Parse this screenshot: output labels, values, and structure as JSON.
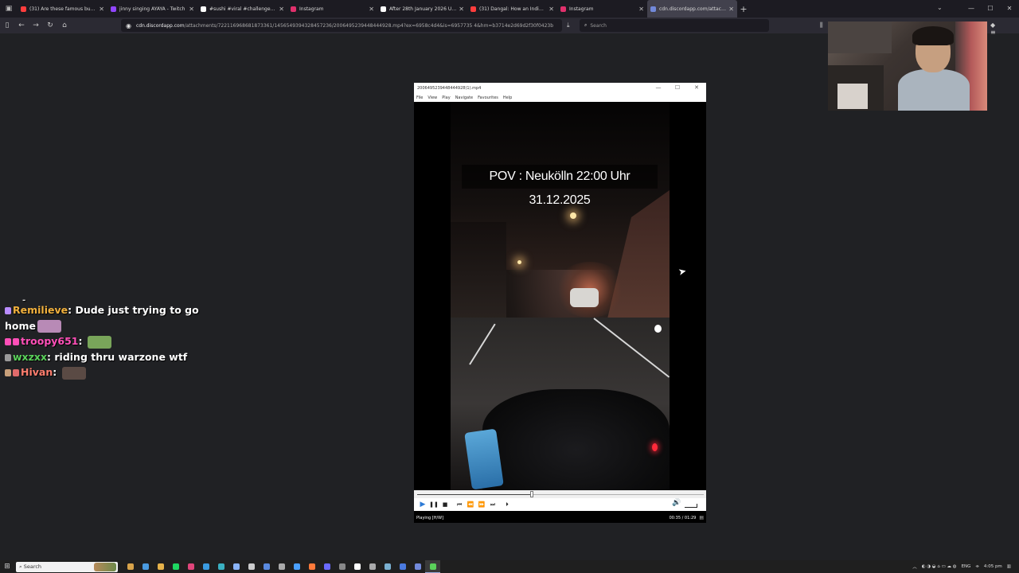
{
  "browser": {
    "tabs": [
      {
        "title": "(31) Are these famous butter c",
        "color": "#ff3d3d",
        "active": false
      },
      {
        "title": "jinny singing AYAYA - Twitch",
        "color": "#9146ff",
        "active": false
      },
      {
        "title": "#sushi #viral #challenge #puzzl",
        "color": "#ffffff",
        "active": false
      },
      {
        "title": "Instagram",
        "color": "#e1306c",
        "active": false
      },
      {
        "title": "After 28th January 2026 U Can",
        "color": "#ffffff",
        "active": false
      },
      {
        "title": "(31) Dangal: How an Indian Fil",
        "color": "#ff3d3d",
        "active": false
      },
      {
        "title": "Instagram",
        "color": "#e1306c",
        "active": false
      },
      {
        "title": "cdn.discordapp.com/attachments/7",
        "color": "#7289da",
        "active": true
      }
    ],
    "new_tab": "+",
    "url_domain": "cdn.discordapp.com",
    "url_path": "/attachments/722116968681873361/1456549394328457236/2006495239448444928.mp4?ex=6958c4d4&is=6957735 4&hm=b3714e2d69d2f30f0423b",
    "search_placeholder": "Search"
  },
  "player": {
    "window_title": "2006495239448444928(1).mp4",
    "menu": [
      "File",
      "View",
      "Play",
      "Navigate",
      "Favourites",
      "Help"
    ],
    "video_caption": "POV : Neukölln 22:00 Uhr 31.12.2025",
    "status": "Playing [H/W]",
    "time_current": "00:35",
    "time_total": "01:29",
    "progress": 0.4,
    "controls": [
      "play",
      "pause",
      "stop",
      "prev",
      "rewind",
      "forward",
      "next",
      "step"
    ]
  },
  "chat": [
    {
      "user": "Remilieve",
      "user_color": "#f2b13d",
      "badges": [
        "#b98cff"
      ],
      "message": "Dude just trying to go home",
      "emote": "#b88ab6"
    },
    {
      "user": "troopy651",
      "user_color": "#ff4fb8",
      "badges": [
        "#ff4fb8",
        "#ff4fb8"
      ],
      "message": "",
      "emote": "#79a55a"
    },
    {
      "user": "wxzxx",
      "user_color": "#5ad15a",
      "badges": [
        "#9a9a9a"
      ],
      "message": "riding thru warzone wtf",
      "emote": ""
    },
    {
      "user": "Hivan",
      "user_color": "#ff7e6e",
      "badges": [
        "#c8a07a",
        "#e06a6a"
      ],
      "message": "",
      "emote": "#5a4a44"
    }
  ],
  "taskbar": {
    "search_label": "Search",
    "language": "ENG",
    "clock": "4:05 pm",
    "apps": [
      "#d9a44a",
      "#4a9adf",
      "#e7b34a",
      "#1ed760",
      "#e0457a",
      "#3a9adf",
      "#3ab0c0",
      "#8ab4f8",
      "#cccccc",
      "#5a8adf",
      "#aaaaaa",
      "#4aa0ff",
      "#ff7a3a",
      "#6a6aff",
      "#888888",
      "#ffffff",
      "#aaaaaa",
      "#7ab0d0",
      "#4a7adf",
      "#7289da",
      "#5ad15a"
    ]
  }
}
